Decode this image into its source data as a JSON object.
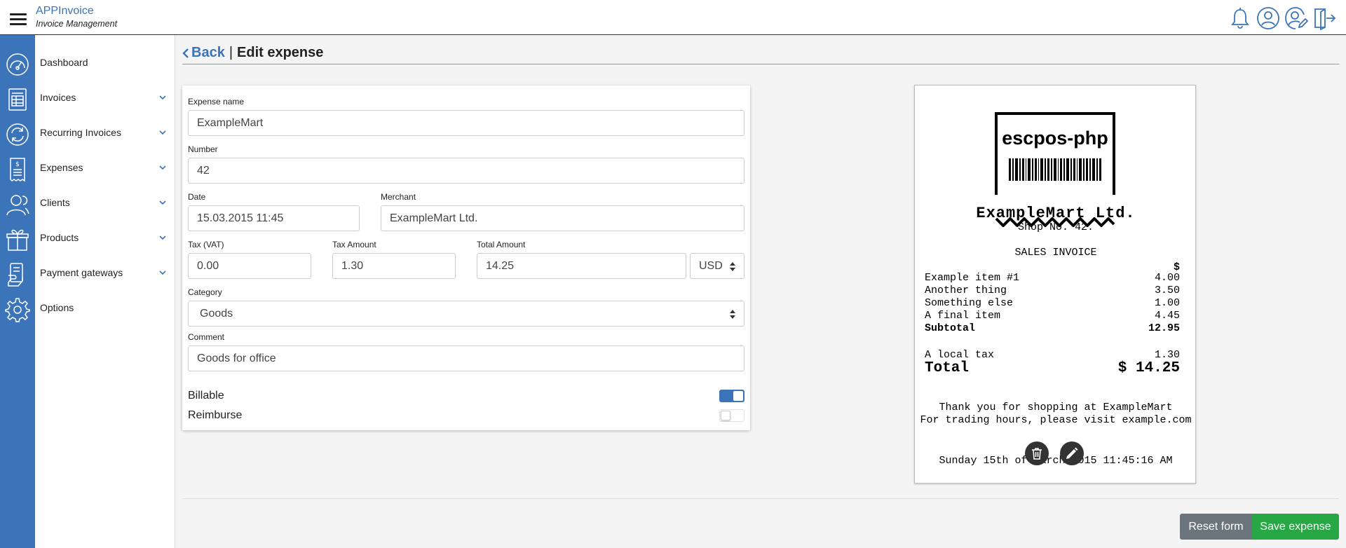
{
  "header": {
    "app_name": "APPInvoice",
    "app_subtitle": "Invoice Management",
    "icons": [
      "bell-icon",
      "user-icon",
      "user-edit-icon",
      "logout-icon"
    ]
  },
  "sidebar": {
    "items": [
      {
        "label": "Dashboard",
        "icon": "dashboard-icon",
        "expandable": false
      },
      {
        "label": "Invoices",
        "icon": "invoice-icon",
        "expandable": true
      },
      {
        "label": "Recurring Invoices",
        "icon": "recurring-icon",
        "expandable": true
      },
      {
        "label": "Expenses",
        "icon": "expense-icon",
        "expandable": true
      },
      {
        "label": "Clients",
        "icon": "clients-icon",
        "expandable": true
      },
      {
        "label": "Products",
        "icon": "products-icon",
        "expandable": true
      },
      {
        "label": "Payment gateways",
        "icon": "payment-icon",
        "expandable": true
      },
      {
        "label": "Options",
        "icon": "gear-icon",
        "expandable": false
      }
    ]
  },
  "page": {
    "back_label": "Back",
    "separator": "|",
    "title": "Edit expense"
  },
  "form": {
    "expense_name_label": "Expense name",
    "expense_name_value": "ExampleMart",
    "number_label": "Number",
    "number_value": "42",
    "date_label": "Date",
    "date_value": "15.03.2015 11:45",
    "merchant_label": "Merchant",
    "merchant_value": "ExampleMart Ltd.",
    "tax_label": "Tax (VAT)",
    "tax_value": "0.00",
    "tax_amount_label": "Tax Amount",
    "tax_amount_value": "1.30",
    "total_amount_label": "Total Amount",
    "total_amount_value": "14.25",
    "currency_value": "USD",
    "category_label": "Category",
    "category_value": "Goods",
    "comment_label": "Comment",
    "comment_value": "Goods for office",
    "billable_label": "Billable",
    "billable_on": true,
    "reimburse_label": "Reimburse",
    "reimburse_on": false
  },
  "receipt": {
    "logo_text": "escpos-php",
    "store_name": "ExampleMart Ltd.",
    "shop_no": "Shop No. 42.",
    "heading": "SALES INVOICE",
    "currency_symbol": "$",
    "lines": [
      {
        "item": "Example item #1",
        "amount": "4.00"
      },
      {
        "item": "Another thing",
        "amount": "3.50"
      },
      {
        "item": "Something else",
        "amount": "1.00"
      },
      {
        "item": "A final item",
        "amount": "4.45"
      }
    ],
    "subtotal_label": "Subtotal",
    "subtotal_value": "12.95",
    "tax_label": "A local tax",
    "tax_value": "1.30",
    "total_label": "Total",
    "total_value": "$ 14.25",
    "thanks_line": "Thank you for shopping at ExampleMart",
    "hours_line": "For trading hours, please visit example.com",
    "date_line": "Sunday 15th of March 2015 11:45:16 AM"
  },
  "actions": {
    "reset_label": "Reset form",
    "save_label": "Save expense"
  },
  "colors": {
    "brand_blue": "#3c74b9",
    "save_green": "#28a745",
    "reset_gray": "#6c757d"
  }
}
